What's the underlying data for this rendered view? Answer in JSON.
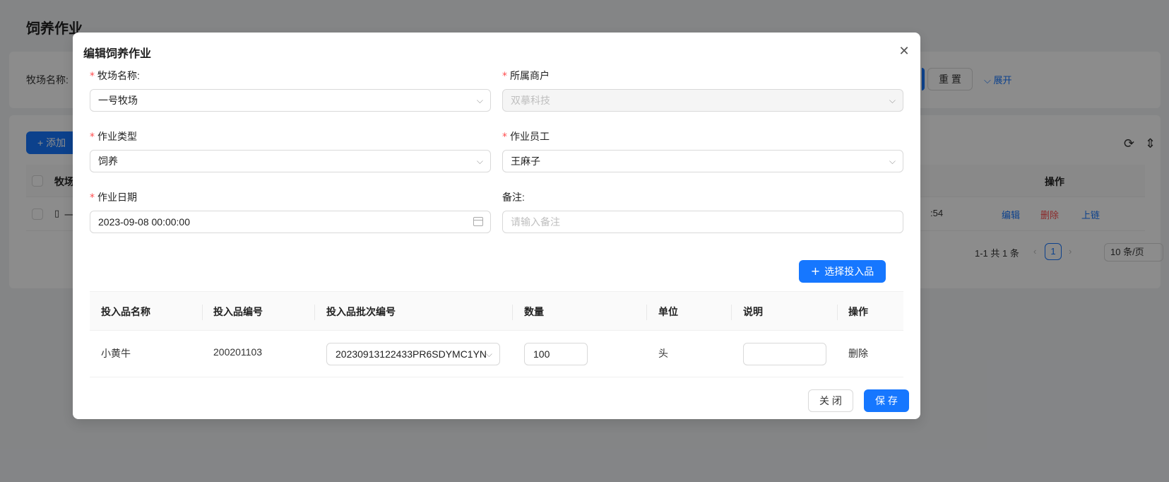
{
  "page": {
    "title": "饲养作业",
    "search_label": "牧场名称:",
    "reset_button": "重 置",
    "expand_button": "展开",
    "add_button": "添加",
    "table_col_farm": "牧场",
    "table_col_actions": "操作",
    "row_time_fragment": ":54",
    "row_farm_fragment": "一",
    "row_actions": {
      "edit": "编辑",
      "delete": "删除",
      "chain": "上链"
    },
    "pagination": {
      "summary": "1-1 共 1 条",
      "current_page": "1",
      "page_size": "10 条/页"
    }
  },
  "modal": {
    "title": "编辑饲养作业",
    "fields": {
      "farm_name": {
        "label": "牧场名称:",
        "value": "一号牧场",
        "required": true
      },
      "merchant": {
        "label": "所属商户",
        "value": "双摹科技",
        "required": true,
        "disabled": true
      },
      "work_type": {
        "label": "作业类型",
        "value": "饲养",
        "required": true
      },
      "worker": {
        "label": "作业员工",
        "value": "王麻子",
        "required": true
      },
      "work_date": {
        "label": "作业日期",
        "value": "2023-09-08 00:00:00",
        "required": true
      },
      "remark": {
        "label": "备注:",
        "placeholder": "请输入备注"
      }
    },
    "select_inputs_button": "选择投入品",
    "inputs_table": {
      "columns": [
        "投入品名称",
        "投入品编号",
        "投入品批次编号",
        "数量",
        "单位",
        "说明",
        "操作"
      ],
      "rows": [
        {
          "name": "小黄牛",
          "code": "200201103",
          "batch": "20230913122433PR6SDYMC1YN",
          "quantity": "100",
          "unit": "头",
          "note": "",
          "action": "删除"
        }
      ]
    },
    "close_button": "关 闭",
    "save_button": "保 存"
  },
  "colors": {
    "primary": "#1677ff",
    "danger": "#ff4d4f",
    "mask": "rgba(0,0,0,0.45)"
  }
}
